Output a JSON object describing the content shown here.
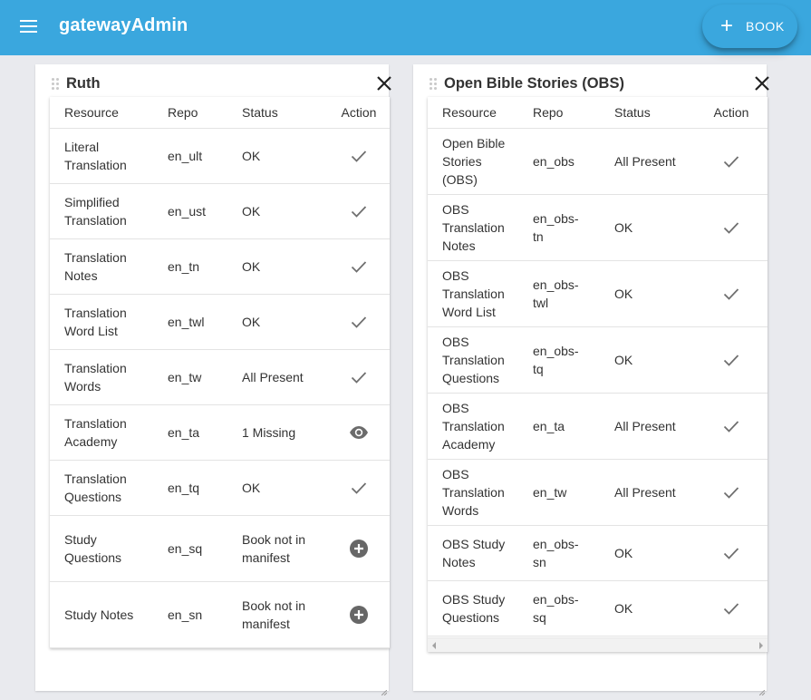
{
  "app": {
    "title": "gatewayAdmin",
    "add_book_label": "BOOK",
    "brand_color": "#3aa7de"
  },
  "icons": {
    "menu": "menu-icon",
    "add": "plus-icon",
    "close": "close-icon",
    "ok": "check-icon",
    "view": "eye-icon",
    "add_resource": "plus-circle-icon"
  },
  "cards": [
    {
      "title": "Ruth",
      "headers": [
        "Resource",
        "Repo",
        "Status",
        "Action"
      ],
      "rows": [
        {
          "resource": "Literal Translation",
          "repo": "en_ult",
          "status": "OK",
          "action": "check"
        },
        {
          "resource": "Simplified Translation",
          "repo": "en_ust",
          "status": "OK",
          "action": "check"
        },
        {
          "resource": "Translation Notes",
          "repo": "en_tn",
          "status": "OK",
          "action": "check"
        },
        {
          "resource": "Translation Word List",
          "repo": "en_twl",
          "status": "OK",
          "action": "check"
        },
        {
          "resource": "Translation Words",
          "repo": "en_tw",
          "status": "All Present",
          "action": "check"
        },
        {
          "resource": "Translation Academy",
          "repo": "en_ta",
          "status": "1 Missing",
          "action": "view"
        },
        {
          "resource": "Translation Questions",
          "repo": "en_tq",
          "status": "OK",
          "action": "check"
        },
        {
          "resource": "Study Questions",
          "repo": "en_sq",
          "status": "Book not in manifest",
          "action": "add"
        },
        {
          "resource": "Study Notes",
          "repo": "en_sn",
          "status": "Book not in manifest",
          "action": "add"
        }
      ]
    },
    {
      "title": "Open Bible Stories (OBS)",
      "headers": [
        "Resource",
        "Repo",
        "Status",
        "Action"
      ],
      "rows": [
        {
          "resource": "Open Bible Stories (OBS)",
          "repo": "en_obs",
          "status": "All Present",
          "action": "check"
        },
        {
          "resource": "OBS Translation Notes",
          "repo": "en_obs-tn",
          "status": "OK",
          "action": "check"
        },
        {
          "resource": "OBS Translation Word List",
          "repo": "en_obs-twl",
          "status": "OK",
          "action": "check"
        },
        {
          "resource": "OBS Translation Questions",
          "repo": "en_obs-tq",
          "status": "OK",
          "action": "check"
        },
        {
          "resource": "OBS Translation Academy",
          "repo": "en_ta",
          "status": "All Present",
          "action": "check"
        },
        {
          "resource": "OBS Translation Words",
          "repo": "en_tw",
          "status": "All Present",
          "action": "check"
        },
        {
          "resource": "OBS Study Notes",
          "repo": "en_obs-sn",
          "status": "OK",
          "action": "check"
        },
        {
          "resource": "OBS Study Questions",
          "repo": "en_obs-sq",
          "status": "OK",
          "action": "check"
        }
      ]
    }
  ]
}
